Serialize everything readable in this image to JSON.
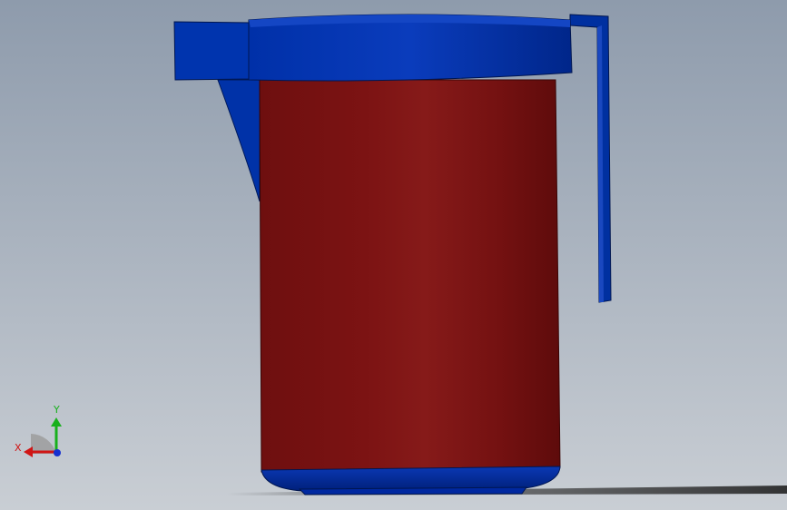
{
  "viewport": {
    "background_top": "#8e9bac",
    "background_bottom": "#c9ced4"
  },
  "model": {
    "name": "pitcher",
    "body_color": "#7a1212",
    "body_highlight": "#8a1c1c",
    "lid_color": "#0033a8",
    "lid_dark": "#00227a",
    "handle_color": "#0030a0"
  },
  "triad": {
    "x_label": "X",
    "y_label": "Y",
    "x_color": "#d01515",
    "y_color": "#18b01c",
    "z_color": "#1530d0"
  }
}
